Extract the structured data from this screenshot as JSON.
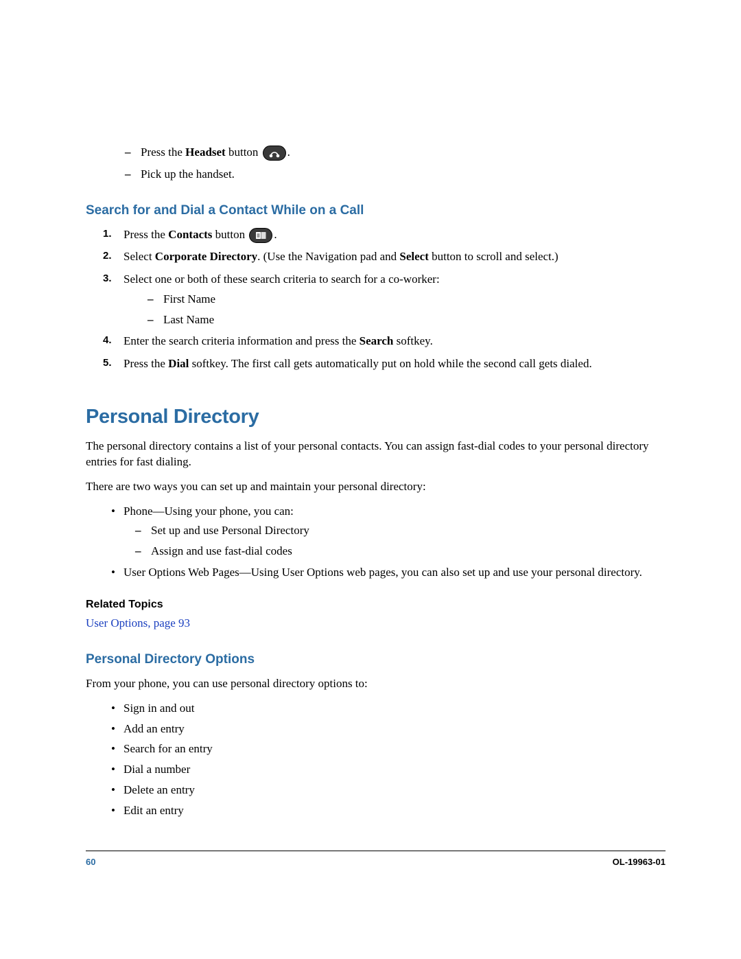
{
  "intro_list": {
    "item1_pre": "Press the ",
    "item1_bold": "Headset",
    "item1_post": " button ",
    "item1_end": ".",
    "item2": "Pick up the handset."
  },
  "heading_search": "Search for and Dial a Contact While on a Call",
  "steps": {
    "s1": {
      "num": "1.",
      "pre": "Press the ",
      "bold": "Contacts",
      "post": " button ",
      "end": "."
    },
    "s2": {
      "num": "2.",
      "pre": "Select ",
      "bold1": "Corporate Directory",
      "mid": ". (Use the Navigation pad and ",
      "bold2": "Select",
      "post": " button to scroll and select.)"
    },
    "s3": {
      "num": "3.",
      "text": "Select one or both of these search criteria to search for a co-worker:"
    },
    "criteria1": "First Name",
    "criteria2": "Last Name",
    "s4": {
      "num": "4.",
      "pre": "Enter the search criteria information and press the ",
      "bold": "Search",
      "post": " softkey."
    },
    "s5": {
      "num": "5.",
      "pre": "Press the ",
      "bold": "Dial",
      "post": " softkey. The first call gets automatically put on hold while the second call gets dialed."
    }
  },
  "heading_pd": "Personal Directory",
  "pd_para1": "The personal directory contains a list of your personal contacts. You can assign fast-dial codes to your personal directory entries for fast dialing.",
  "pd_para2": "There are two ways you can set up and maintain your personal directory:",
  "pd_list": {
    "item1": "Phone—Using your phone, you can:",
    "sub1": "Set up and use Personal Directory",
    "sub2": "Assign and use fast-dial codes",
    "item2": "User Options Web Pages—Using User Options web pages, you can also set up and use your personal directory."
  },
  "related_heading": "Related Topics",
  "related_link": "User Options, page 93",
  "heading_pdo": "Personal Directory Options",
  "pdo_intro": "From your phone, you can use personal directory options to:",
  "pdo_list": {
    "i1": "Sign in and out",
    "i2": "Add an entry",
    "i3": "Search for an entry",
    "i4": "Dial a number",
    "i5": "Delete an entry",
    "i6": "Edit an entry"
  },
  "footer": {
    "page": "60",
    "docid": "OL-19963-01"
  }
}
